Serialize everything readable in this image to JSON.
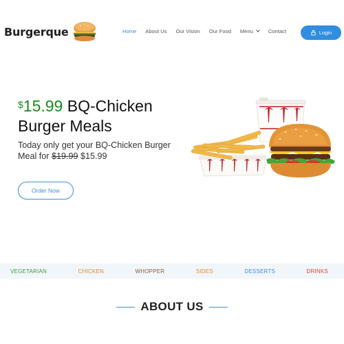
{
  "header": {
    "logo_text": "Burgerque",
    "logo_icon": "burger-icon",
    "nav": [
      {
        "label": "Home",
        "active": true
      },
      {
        "label": "About Us"
      },
      {
        "label": "Our Vision"
      },
      {
        "label": "Our Food"
      },
      {
        "label": "Menu",
        "has_dropdown": true
      },
      {
        "label": "Contact"
      }
    ],
    "login_label": "Login",
    "login_icon": "lock-icon"
  },
  "hero": {
    "price_symbol": "$",
    "price": "15.99",
    "title_rest": "BQ-Chicken",
    "title_line2": "Burger Meals",
    "sub_text": "Today only get your BQ-Chicken Burger Meal for",
    "old_price": "$19.99",
    "new_price": "$15.99",
    "cta": "Order Now"
  },
  "categories": [
    {
      "label": "VEGETARIAN",
      "color": "#3d9a3d"
    },
    {
      "label": "CHICKEN",
      "color": "#e08a2c"
    },
    {
      "label": "WHOPPER",
      "color": "#8a5a3c"
    },
    {
      "label": "SIDES",
      "color": "#e08a2c"
    },
    {
      "label": "DESSERTS",
      "color": "#3d8ed8"
    },
    {
      "label": "DRINKS",
      "color": "#e0403a"
    }
  ],
  "about": {
    "title": "ABOUT US"
  },
  "colors": {
    "accent": "#3d8ed8",
    "price_green": "#1a8a1a",
    "login_bg": "#2f8ee0"
  }
}
